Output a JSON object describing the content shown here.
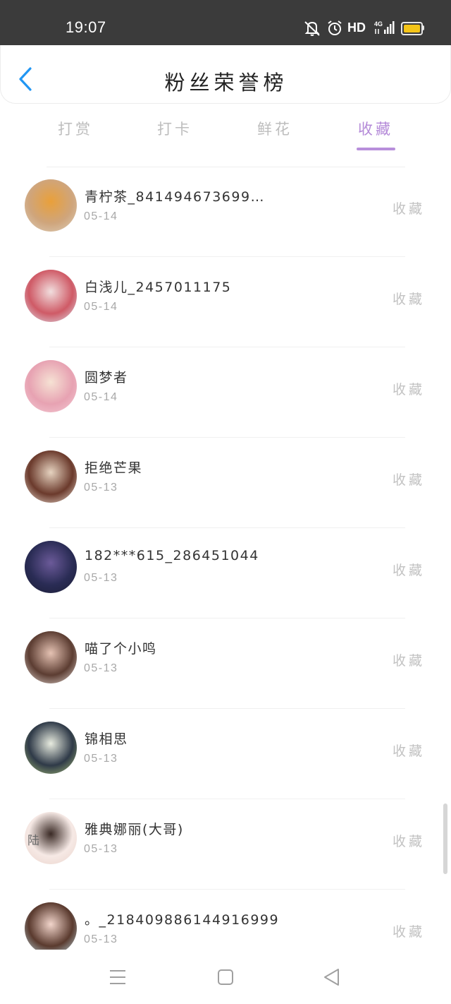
{
  "status_bar": {
    "time": "19:07",
    "hd_label": "HD",
    "network_label": "4G",
    "icons": [
      "bell-muted-icon",
      "alarm-icon",
      "signal-icon",
      "battery-icon"
    ]
  },
  "header": {
    "title": "粉丝荣誉榜",
    "back_icon": "chevron-left-icon"
  },
  "tabs": [
    {
      "label": "打赏",
      "active": false
    },
    {
      "label": "打卡",
      "active": false
    },
    {
      "label": "鲜花",
      "active": false
    },
    {
      "label": "收藏",
      "active": true
    }
  ],
  "list": [
    {
      "name": "青柠茶_841494673699…",
      "date": "05-14",
      "action_label": "收藏",
      "avatar_colors": [
        "#e9a03a",
        "#cfa57c",
        "#ddd0bd"
      ]
    },
    {
      "name": "白浅儿_2457011175",
      "date": "05-14",
      "action_label": "收藏",
      "avatar_colors": [
        "#f1dede",
        "#cf5a66",
        "#dce6f0"
      ]
    },
    {
      "name": "圆梦者",
      "date": "05-14",
      "action_label": "收藏",
      "avatar_colors": [
        "#f6e2d4",
        "#e7a2b2",
        "#f4ccd6"
      ]
    },
    {
      "name": "拒绝芒果",
      "date": "05-13",
      "action_label": "收藏",
      "avatar_colors": [
        "#e6d3c0",
        "#6b3a2c",
        "#efe2d6"
      ]
    },
    {
      "name": "182***615_286451044",
      "date": "05-13",
      "action_label": "收藏",
      "avatar_colors": [
        "#6b5a99",
        "#2a2c55",
        "#1b1d35"
      ]
    },
    {
      "name": "喵了个小鸣",
      "date": "05-13",
      "action_label": "收藏",
      "avatar_colors": [
        "#e5c2b3",
        "#5c3d32",
        "#e8ddd8"
      ]
    },
    {
      "name": "锦相思",
      "date": "05-13",
      "action_label": "收藏",
      "avatar_colors": [
        "#e8ece0",
        "#2f3a48",
        "#a7bf78"
      ]
    },
    {
      "name": "雅典娜丽(大哥)",
      "date": "05-13",
      "action_label": "收藏",
      "avatar_colors": [
        "#3a2a25",
        "#f6e9e5",
        "#ead3cb"
      ],
      "avatar_text": "陆"
    },
    {
      "name": "。_218409886144916999",
      "date": "05-13",
      "action_label": "收藏",
      "avatar_colors": [
        "#f2d5cb",
        "#5a3a2e",
        "#bfe0ea"
      ]
    }
  ],
  "colors": {
    "status_bar_bg": "#3b3b3b",
    "accent_purple": "#b48ad8",
    "back_blue": "#2196f3",
    "battery_yellow": "#f5c518"
  },
  "bottom_nav": {
    "icons": [
      "menu-icon",
      "home-square-icon",
      "back-triangle-icon"
    ]
  }
}
